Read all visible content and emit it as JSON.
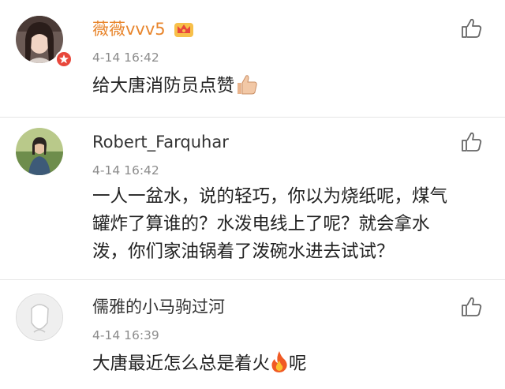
{
  "comments": [
    {
      "username": "薇薇vvv5",
      "username_color": "#e8852c",
      "badge": "vip-crown-icon",
      "time": "4-14 16:42",
      "text": "给大唐消防员点赞",
      "emoji": "thumbs-up-emoji"
    },
    {
      "username": "Robert_Farquhar",
      "username_color": "#333333",
      "time": "4-14 16:42",
      "text": "一人一盆水，说的轻巧，你以为烧纸呢，煤气罐炸了算谁的？水泼电线上了呢？就会拿水泼，你们家油锅着了泼碗水进去试试？"
    },
    {
      "username": "儒雅的小马驹过河",
      "username_color": "#333333",
      "time": "4-14 16:39",
      "text_before": "大唐最近怎么总是着火",
      "emoji": "fire-emoji",
      "text_after": "呢"
    }
  ]
}
